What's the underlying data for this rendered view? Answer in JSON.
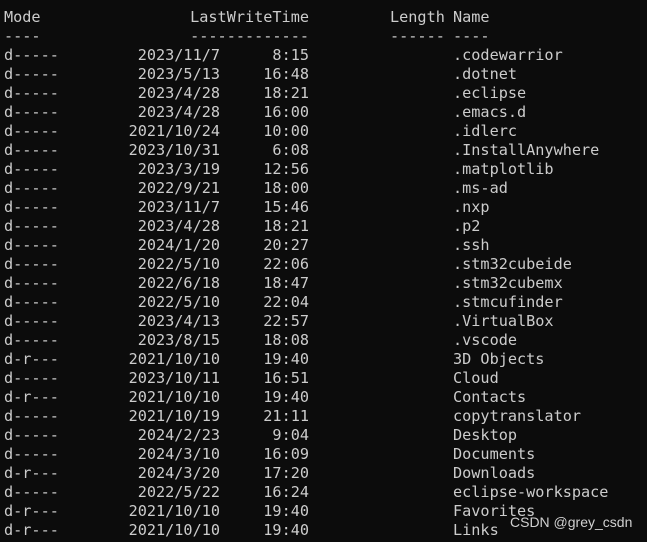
{
  "terminal": {
    "headers": {
      "mode": "Mode",
      "last_write_time": "LastWriteTime",
      "length": "Length",
      "name": "Name"
    },
    "underlines": {
      "mode": "----",
      "last_write_time": "-------------",
      "length": "------",
      "name": "----"
    },
    "rows": [
      {
        "mode": "d-----",
        "date": "2023/11/7",
        "time": "8:15",
        "length": "",
        "name": ".codewarrior"
      },
      {
        "mode": "d-----",
        "date": "2023/5/13",
        "time": "16:48",
        "length": "",
        "name": ".dotnet"
      },
      {
        "mode": "d-----",
        "date": "2023/4/28",
        "time": "18:21",
        "length": "",
        "name": ".eclipse"
      },
      {
        "mode": "d-----",
        "date": "2023/4/28",
        "time": "16:00",
        "length": "",
        "name": ".emacs.d"
      },
      {
        "mode": "d-----",
        "date": "2021/10/24",
        "time": "10:00",
        "length": "",
        "name": ".idlerc"
      },
      {
        "mode": "d-----",
        "date": "2023/10/31",
        "time": "6:08",
        "length": "",
        "name": ".InstallAnywhere"
      },
      {
        "mode": "d-----",
        "date": "2023/3/19",
        "time": "12:56",
        "length": "",
        "name": ".matplotlib"
      },
      {
        "mode": "d-----",
        "date": "2022/9/21",
        "time": "18:00",
        "length": "",
        "name": ".ms-ad"
      },
      {
        "mode": "d-----",
        "date": "2023/11/7",
        "time": "15:46",
        "length": "",
        "name": ".nxp"
      },
      {
        "mode": "d-----",
        "date": "2023/4/28",
        "time": "18:21",
        "length": "",
        "name": ".p2"
      },
      {
        "mode": "d-----",
        "date": "2024/1/20",
        "time": "20:27",
        "length": "",
        "name": ".ssh"
      },
      {
        "mode": "d-----",
        "date": "2022/5/10",
        "time": "22:06",
        "length": "",
        "name": ".stm32cubeide"
      },
      {
        "mode": "d-----",
        "date": "2022/6/18",
        "time": "18:47",
        "length": "",
        "name": ".stm32cubemx"
      },
      {
        "mode": "d-----",
        "date": "2022/5/10",
        "time": "22:04",
        "length": "",
        "name": ".stmcufinder"
      },
      {
        "mode": "d-----",
        "date": "2023/4/13",
        "time": "22:57",
        "length": "",
        "name": ".VirtualBox"
      },
      {
        "mode": "d-----",
        "date": "2023/8/15",
        "time": "18:08",
        "length": "",
        "name": ".vscode"
      },
      {
        "mode": "d-r---",
        "date": "2021/10/10",
        "time": "19:40",
        "length": "",
        "name": "3D Objects"
      },
      {
        "mode": "d-----",
        "date": "2023/10/11",
        "time": "16:51",
        "length": "",
        "name": "Cloud"
      },
      {
        "mode": "d-r---",
        "date": "2021/10/10",
        "time": "19:40",
        "length": "",
        "name": "Contacts"
      },
      {
        "mode": "d-----",
        "date": "2021/10/19",
        "time": "21:11",
        "length": "",
        "name": "copytranslator"
      },
      {
        "mode": "d-----",
        "date": "2024/2/23",
        "time": "9:04",
        "length": "",
        "name": "Desktop"
      },
      {
        "mode": "d-----",
        "date": "2024/3/10",
        "time": "16:09",
        "length": "",
        "name": "Documents"
      },
      {
        "mode": "d-r---",
        "date": "2024/3/20",
        "time": "17:20",
        "length": "",
        "name": "Downloads"
      },
      {
        "mode": "d-----",
        "date": "2022/5/22",
        "time": "16:24",
        "length": "",
        "name": "eclipse-workspace"
      },
      {
        "mode": "d-r---",
        "date": "2021/10/10",
        "time": "19:40",
        "length": "",
        "name": "Favorites"
      },
      {
        "mode": "d-r---",
        "date": "2021/10/10",
        "time": "19:40",
        "length": "",
        "name": "Links"
      }
    ]
  },
  "watermark": "CSDN @grey_csdn",
  "colors": {
    "background": "#0c0c0c",
    "foreground": "#cccccc"
  }
}
